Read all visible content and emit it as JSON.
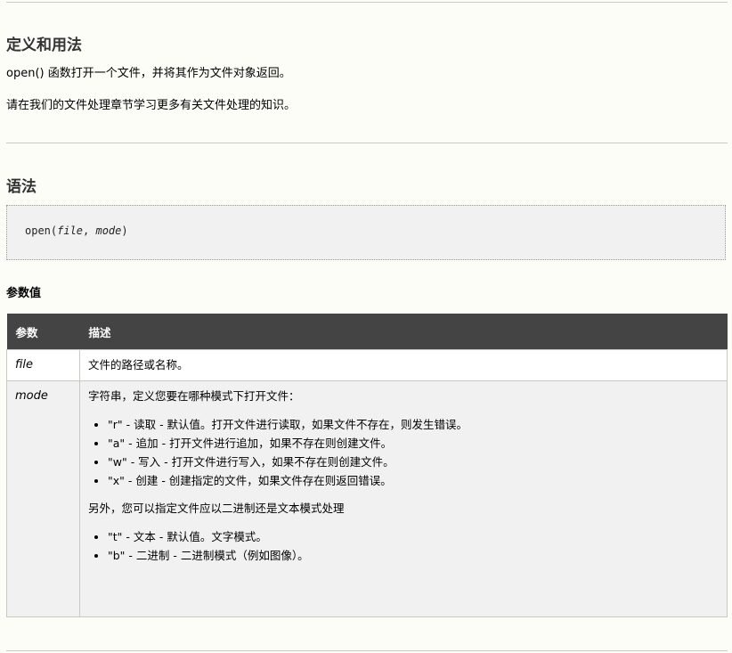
{
  "section_definition": {
    "heading": "定义和用法",
    "para1": "open() 函数打开一个文件，并将其作为文件对象返回。",
    "para2": "请在我们的文件处理章节学习更多有关文件处理的知识。"
  },
  "section_syntax": {
    "heading": "语法",
    "code_func": "open(",
    "code_arg1": "file",
    "code_sep": ", ",
    "code_arg2": "mode",
    "code_close": ")"
  },
  "params": {
    "heading": "参数值",
    "table": {
      "headers": [
        "参数",
        "描述"
      ],
      "rows": [
        {
          "name": "file",
          "desc": "文件的路径或名称。"
        },
        {
          "name": "mode",
          "intro": "字符串，定义您要在哪种模式下打开文件：",
          "modes": [
            "\"r\" - 读取 - 默认值。打开文件进行读取，如果文件不存在，则发生错误。",
            "\"a\" - 追加 - 打开文件进行追加，如果不存在则创建文件。",
            "\"w\" - 写入 - 打开文件进行写入，如果不存在则创建文件。",
            "\"x\" - 创建 - 创建指定的文件，如果文件存在则返回错误。"
          ],
          "extra": "另外，您可以指定文件应以二进制还是文本模式处理",
          "extra_modes": [
            "\"t\" - 文本 - 默认值。文字模式。",
            "\"b\" - 二进制 - 二进制模式（例如图像）。"
          ]
        }
      ]
    }
  }
}
